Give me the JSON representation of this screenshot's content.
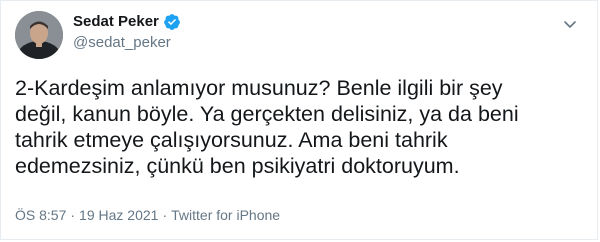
{
  "tweet": {
    "author": {
      "display_name": "Sedat Peker",
      "handle": "@sedat_peker",
      "verified": true
    },
    "text": "2-Kardeşim anlamıyor musunuz? Benle ilgili bir şey\ndeğil, kanun böyle. Ya gerçekten delisiniz, ya da beni\ntahrik etmeye çalışıyorsunuz. Ama beni tahrik\nedemezsiniz, çünkü ben psikiyatri doktoruyum.",
    "time": "ÖS 8:57",
    "separator": "·",
    "date": "19 Haz 2021",
    "source": "Twitter for iPhone"
  },
  "colors": {
    "verified": "#1da1f2",
    "text": "#14171a",
    "secondary": "#657786",
    "border": "#e6ecf0"
  },
  "icons": {
    "verified": "verified-badge-icon",
    "more": "chevron-down-icon"
  }
}
